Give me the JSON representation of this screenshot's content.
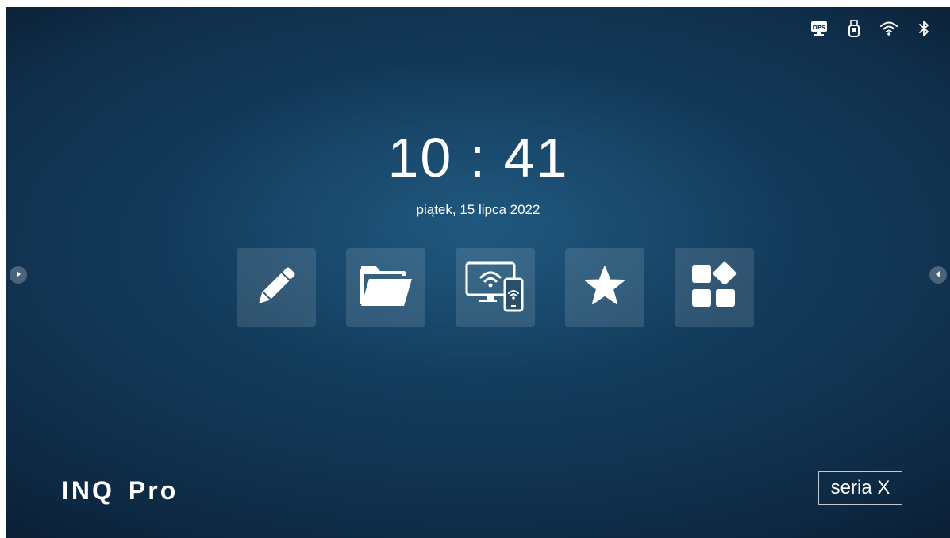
{
  "status_icons": [
    "ops-icon",
    "usb-icon",
    "wifi-icon",
    "bluetooth-icon"
  ],
  "clock": {
    "time": "10 : 41",
    "date": "piątek, 15 lipca 2022"
  },
  "dock": {
    "items": [
      {
        "name": "whiteboard",
        "icon": "pencil-icon"
      },
      {
        "name": "files",
        "icon": "folder-icon"
      },
      {
        "name": "screen-share",
        "icon": "screen-share-icon"
      },
      {
        "name": "favorites",
        "icon": "star-icon"
      },
      {
        "name": "apps",
        "icon": "apps-grid-icon"
      }
    ]
  },
  "branding": {
    "logo_main": "INQ",
    "logo_suffix": "Pro",
    "series": "seria X"
  },
  "colors": {
    "background": "#10324f",
    "tile": "#ffffff1f",
    "text": "#ffffff"
  }
}
